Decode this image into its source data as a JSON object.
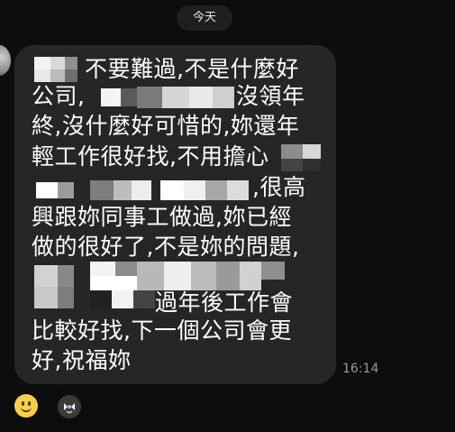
{
  "header": {
    "date_label": "今天"
  },
  "message": {
    "lines": [
      "不要難過,不是什麼好",
      "公司,",
      "沒領年",
      "終,沒什麼好可惜的,妳還年",
      "輕工作很好找,不用擔心",
      ",很高",
      "興跟妳同事工做過,妳已經",
      "做的很好了,不是妳的問題,",
      "過年後工作會",
      "比較好找,下一個公司會更",
      "好,祝福妳"
    ],
    "time": "16:14"
  },
  "actions": {
    "emoji_icon": "smiley-face-icon",
    "reaction_icon": "sticker-reaction-icon"
  },
  "colors": {
    "background": "#0d0d0d",
    "bubble": "#262626",
    "text": "#ffffff",
    "timestamp": "#9a9a9a"
  }
}
